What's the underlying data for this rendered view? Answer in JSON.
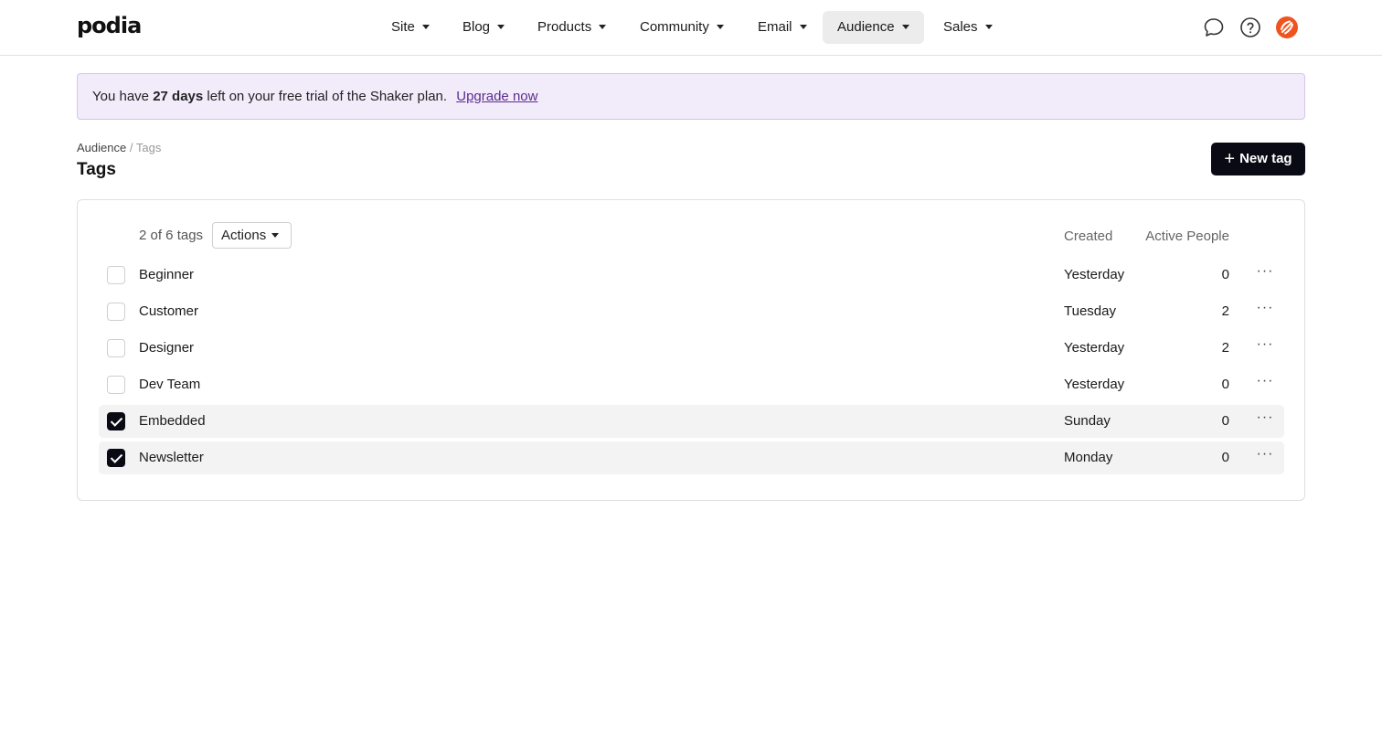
{
  "app": {
    "logo": "podia"
  },
  "nav": {
    "items": [
      {
        "label": "Site"
      },
      {
        "label": "Blog"
      },
      {
        "label": "Products"
      },
      {
        "label": "Community"
      },
      {
        "label": "Email"
      },
      {
        "label": "Audience",
        "active": true
      },
      {
        "label": "Sales"
      }
    ],
    "icons": [
      "chat-icon",
      "help-icon",
      "avatar"
    ]
  },
  "banner": {
    "prefix": "You have",
    "days": "27 days",
    "suffix": "left on your free trial of the Shaker plan.",
    "link": "Upgrade now"
  },
  "breadcrumb": {
    "parent": "Audience",
    "separator": "/",
    "current": "Tags"
  },
  "page": {
    "title": "Tags",
    "new_button": "New tag"
  },
  "table": {
    "count_text": "2 of 6 tags",
    "actions_label": "Actions",
    "columns": {
      "created": "Created",
      "people": "Active People"
    },
    "rows": [
      {
        "name": "Beginner",
        "created": "Yesterday",
        "people": "0",
        "checked": false
      },
      {
        "name": "Customer",
        "created": "Tuesday",
        "people": "2",
        "checked": false
      },
      {
        "name": "Designer",
        "created": "Yesterday",
        "people": "2",
        "checked": false
      },
      {
        "name": "Dev Team",
        "created": "Yesterday",
        "people": "0",
        "checked": false
      },
      {
        "name": "Embedded",
        "created": "Sunday",
        "people": "0",
        "checked": true
      },
      {
        "name": "Newsletter",
        "created": "Monday",
        "people": "0",
        "checked": true
      }
    ],
    "more_icon": "ellipsis-icon"
  },
  "colors": {
    "accent": "#0a0a14",
    "banner_bg": "#f2ebfa",
    "link": "#5b2d8f",
    "avatar": "#f0541e"
  }
}
